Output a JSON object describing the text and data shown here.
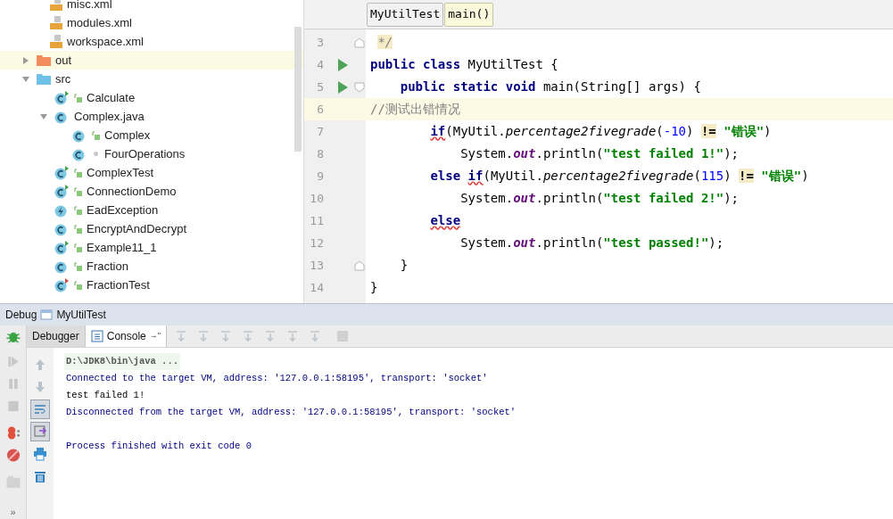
{
  "project_tree": {
    "scrolled_files": [
      {
        "label": "misc.xml",
        "kind": "xml"
      },
      {
        "label": "modules.xml",
        "kind": "xml"
      },
      {
        "label": "workspace.xml",
        "kind": "xml"
      }
    ],
    "items": [
      {
        "label": "out",
        "kind": "folder",
        "color": "#f28c5c",
        "expanded": false,
        "selected": true
      },
      {
        "label": "src",
        "kind": "folder",
        "color": "#6fc1e8",
        "expanded": true,
        "selected": false,
        "children": [
          {
            "label": "Calculate",
            "kind": "main-class",
            "selected": false
          },
          {
            "label": "Complex.java",
            "kind": "java-file",
            "expanded": true,
            "selected": false,
            "children": [
              {
                "label": "Complex",
                "kind": "class",
                "selected": false
              },
              {
                "label": "FourOperations",
                "kind": "inner-class",
                "selected": false
              }
            ]
          },
          {
            "label": "ComplexTest",
            "kind": "main-class",
            "selected": false
          },
          {
            "label": "ConnectionDemo",
            "kind": "main-class",
            "selected": false
          },
          {
            "label": "EadException",
            "kind": "exception",
            "selected": false
          },
          {
            "label": "EncryptAndDecrypt",
            "kind": "class",
            "selected": false
          },
          {
            "label": "Example11_1",
            "kind": "main-class",
            "selected": false
          },
          {
            "label": "Fraction",
            "kind": "class",
            "selected": false
          },
          {
            "label": "FractionTest",
            "kind": "test-class",
            "selected": false
          }
        ]
      }
    ]
  },
  "editor": {
    "breadcrumbs": [
      {
        "label": "MyUtilTest",
        "selected": false
      },
      {
        "label": "main()",
        "selected": true
      }
    ],
    "lines": [
      {
        "number": "3",
        "run": false,
        "fold_start": false,
        "fold_end": true,
        "selected": false,
        "tokens": [
          {
            "kind": "comment-hl",
            "text": " */"
          }
        ]
      },
      {
        "number": "4",
        "run": true,
        "fold_start": false,
        "fold_end": false,
        "selected": false,
        "tokens": [
          {
            "kind": "keyword",
            "text": "public class "
          },
          {
            "kind": "plain",
            "text": "MyUtilTest {"
          }
        ]
      },
      {
        "number": "5",
        "run": true,
        "fold_start": true,
        "fold_end": false,
        "selected": false,
        "tokens": [
          {
            "kind": "keyword",
            "text": "    public static void "
          },
          {
            "kind": "plain",
            "text": "main(String[] args) {"
          }
        ]
      },
      {
        "number": "6",
        "run": false,
        "fold_start": false,
        "fold_end": false,
        "selected": true,
        "tokens": [
          {
            "kind": "comment",
            "text": "//测试出错情况"
          }
        ]
      },
      {
        "number": "7",
        "run": false,
        "fold_start": false,
        "fold_end": false,
        "selected": false,
        "tokens": [
          {
            "kind": "warn-keyword",
            "text": "        if"
          },
          {
            "kind": "plain",
            "text": "(MyUtil."
          },
          {
            "kind": "method",
            "text": "percentage2fivegrade"
          },
          {
            "kind": "plain",
            "text": "("
          },
          {
            "kind": "number",
            "text": "-10"
          },
          {
            "kind": "plain",
            "text": ") "
          },
          {
            "kind": "match",
            "text": "!="
          },
          {
            "kind": "string",
            "text": " \"错误\""
          },
          {
            "kind": "plain",
            "text": ")"
          }
        ]
      },
      {
        "number": "8",
        "run": false,
        "fold_start": false,
        "fold_end": false,
        "selected": false,
        "tokens": [
          {
            "kind": "plain",
            "text": "            System."
          },
          {
            "kind": "field",
            "text": "out"
          },
          {
            "kind": "plain",
            "text": ".println("
          },
          {
            "kind": "string",
            "text": "\"test failed 1!\""
          },
          {
            "kind": "plain",
            "text": ");"
          }
        ]
      },
      {
        "number": "9",
        "run": false,
        "fold_start": false,
        "fold_end": false,
        "selected": false,
        "tokens": [
          {
            "kind": "keyword",
            "text": "        else "
          },
          {
            "kind": "warn-keyword",
            "text": "if"
          },
          {
            "kind": "plain",
            "text": "(MyUtil."
          },
          {
            "kind": "method",
            "text": "percentage2fivegrade"
          },
          {
            "kind": "plain",
            "text": "("
          },
          {
            "kind": "number",
            "text": "115"
          },
          {
            "kind": "plain",
            "text": ") "
          },
          {
            "kind": "match",
            "text": "!="
          },
          {
            "kind": "string",
            "text": " \"错误\""
          },
          {
            "kind": "plain",
            "text": ")"
          }
        ]
      },
      {
        "number": "10",
        "run": false,
        "fold_start": false,
        "fold_end": false,
        "selected": false,
        "tokens": [
          {
            "kind": "plain",
            "text": "            System."
          },
          {
            "kind": "field",
            "text": "out"
          },
          {
            "kind": "plain",
            "text": ".println("
          },
          {
            "kind": "string",
            "text": "\"test failed 2!\""
          },
          {
            "kind": "plain",
            "text": ");"
          }
        ]
      },
      {
        "number": "11",
        "run": false,
        "fold_start": false,
        "fold_end": false,
        "selected": false,
        "tokens": [
          {
            "kind": "warn-keyword",
            "text": "        else"
          }
        ]
      },
      {
        "number": "12",
        "run": false,
        "fold_start": false,
        "fold_end": false,
        "selected": false,
        "tokens": [
          {
            "kind": "plain",
            "text": "            System."
          },
          {
            "kind": "field",
            "text": "out"
          },
          {
            "kind": "plain",
            "text": ".println("
          },
          {
            "kind": "string",
            "text": "\"test passed!\""
          },
          {
            "kind": "plain",
            "text": ");"
          }
        ]
      },
      {
        "number": "13",
        "run": false,
        "fold_start": false,
        "fold_end": true,
        "selected": false,
        "tokens": [
          {
            "kind": "plain",
            "text": "    }"
          }
        ]
      },
      {
        "number": "14",
        "run": false,
        "fold_start": false,
        "fold_end": false,
        "selected": false,
        "tokens": [
          {
            "kind": "plain",
            "text": "}"
          }
        ]
      }
    ]
  },
  "debug": {
    "title": "Debug",
    "config": "MyUtilTest",
    "tabs": [
      {
        "label": "Debugger",
        "selected": false
      },
      {
        "label": "Console",
        "pin": "→\"",
        "selected": true
      }
    ],
    "side_tools": [
      {
        "kind": "up",
        "on": false
      },
      {
        "kind": "down",
        "on": false
      },
      {
        "kind": "wrap",
        "on": true
      },
      {
        "kind": "scroll-end",
        "on": true
      },
      {
        "kind": "print",
        "on": false
      },
      {
        "kind": "trash",
        "on": false
      }
    ],
    "more": "»",
    "console": [
      {
        "kind": "command",
        "text": "D:\\JDK8\\bin\\java ..."
      },
      {
        "kind": "system",
        "text": "Connected to the target VM, address: '127.0.0.1:58195', transport: 'socket'"
      },
      {
        "kind": "output",
        "text": "test failed 1!"
      },
      {
        "kind": "system",
        "text": "Disconnected from the target VM, address: '127.0.0.1:58195', transport: 'socket'"
      },
      {
        "kind": "exit",
        "text": "Process finished with exit code 0"
      }
    ]
  }
}
